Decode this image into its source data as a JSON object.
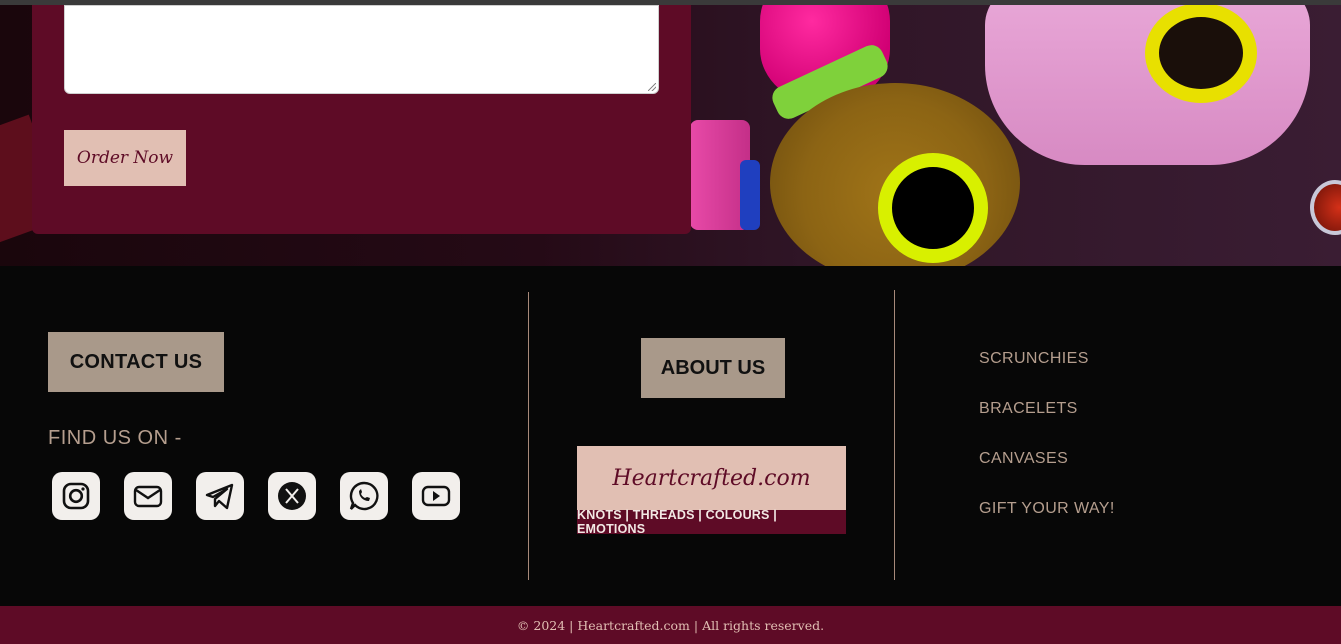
{
  "order_form": {
    "textarea_value": "",
    "order_button": "Order Now"
  },
  "footer": {
    "contact_button": "CONTACT US",
    "find_us_label": "FIND US ON -",
    "socials": [
      {
        "name": "instagram-icon"
      },
      {
        "name": "email-icon"
      },
      {
        "name": "telegram-icon"
      },
      {
        "name": "x-icon"
      },
      {
        "name": "whatsapp-icon"
      },
      {
        "name": "youtube-icon"
      }
    ],
    "about_button": "ABOUT US",
    "logo": {
      "brand": "Heartcrafted.com",
      "tagline": "KNOTS | THREADS | COLOURS | EMOTIONS"
    },
    "links": [
      "SCRUNCHIES",
      "BRACELETS",
      "CANVASES",
      "GIFT YOUR WAY!"
    ]
  },
  "copyright": "© 2024 | Heartcrafted.com | All rights reserved.",
  "colors": {
    "maroon": "#5e0b26",
    "blush": "#e1bfb3",
    "taupe": "#a9998a",
    "link": "#b59e8e",
    "footer_bg": "#070707"
  }
}
